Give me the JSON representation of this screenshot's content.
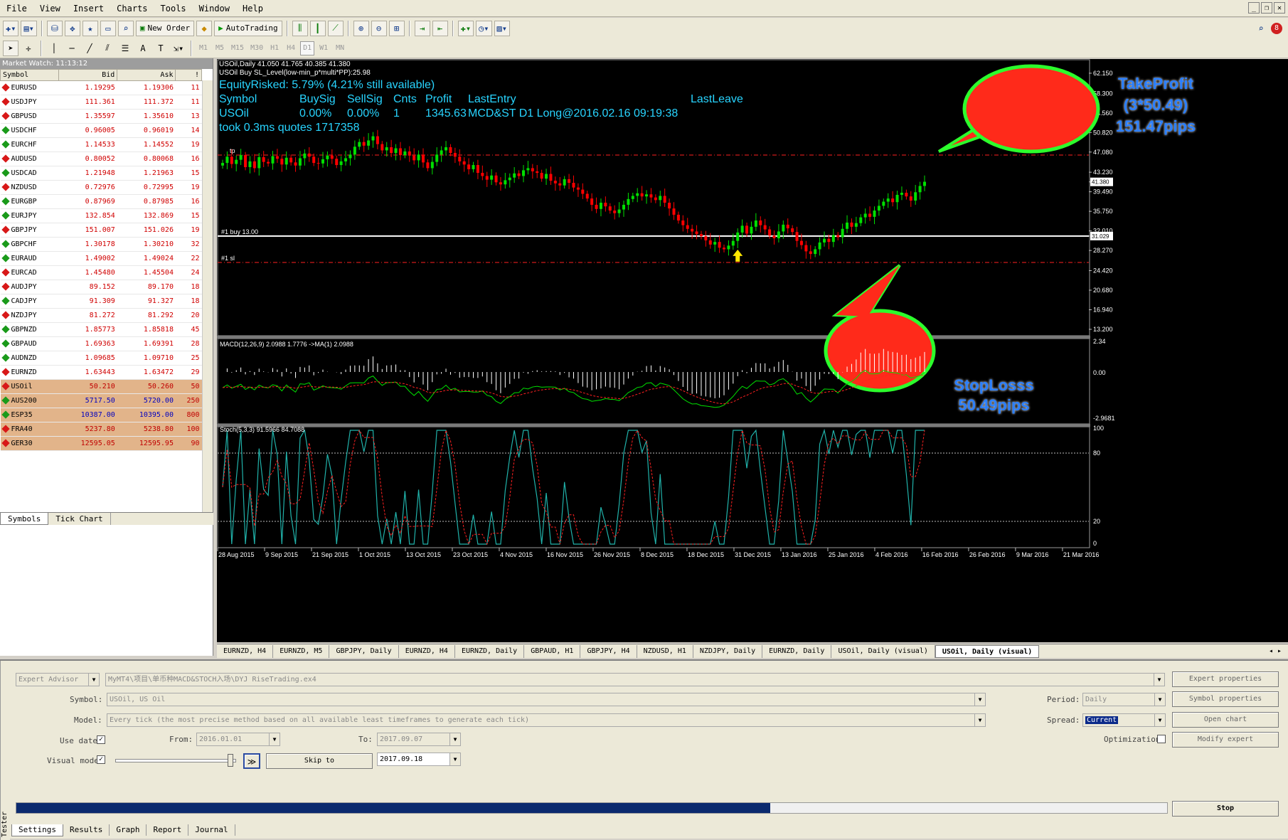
{
  "menu": [
    "File",
    "View",
    "Insert",
    "Charts",
    "Tools",
    "Window",
    "Help"
  ],
  "toolbar": {
    "new_order": "New Order",
    "autotrading": "AutoTrading"
  },
  "timeframes": [
    "M1",
    "M5",
    "M15",
    "M30",
    "H1",
    "H4",
    "D1",
    "W1",
    "MN"
  ],
  "notification_count": "8",
  "market_watch": {
    "title": "Market Watch: 11:13:12",
    "columns": [
      "Symbol",
      "Bid",
      "Ask",
      "!"
    ],
    "rows": [
      {
        "symbol": "EURUSD",
        "bid": "1.19295",
        "ask": "1.19306",
        "spread": "11",
        "dir": "down"
      },
      {
        "symbol": "USDJPY",
        "bid": "111.361",
        "ask": "111.372",
        "spread": "11",
        "dir": "down"
      },
      {
        "symbol": "GBPUSD",
        "bid": "1.35597",
        "ask": "1.35610",
        "spread": "13",
        "dir": "down"
      },
      {
        "symbol": "USDCHF",
        "bid": "0.96005",
        "ask": "0.96019",
        "spread": "14",
        "dir": "up"
      },
      {
        "symbol": "EURCHF",
        "bid": "1.14533",
        "ask": "1.14552",
        "spread": "19",
        "dir": "up"
      },
      {
        "symbol": "AUDUSD",
        "bid": "0.80052",
        "ask": "0.80068",
        "spread": "16",
        "dir": "down"
      },
      {
        "symbol": "USDCAD",
        "bid": "1.21948",
        "ask": "1.21963",
        "spread": "15",
        "dir": "up"
      },
      {
        "symbol": "NZDUSD",
        "bid": "0.72976",
        "ask": "0.72995",
        "spread": "19",
        "dir": "down"
      },
      {
        "symbol": "EURGBP",
        "bid": "0.87969",
        "ask": "0.87985",
        "spread": "16",
        "dir": "up"
      },
      {
        "symbol": "EURJPY",
        "bid": "132.854",
        "ask": "132.869",
        "spread": "15",
        "dir": "up"
      },
      {
        "symbol": "GBPJPY",
        "bid": "151.007",
        "ask": "151.026",
        "spread": "19",
        "dir": "down"
      },
      {
        "symbol": "GBPCHF",
        "bid": "1.30178",
        "ask": "1.30210",
        "spread": "32",
        "dir": "up"
      },
      {
        "symbol": "EURAUD",
        "bid": "1.49002",
        "ask": "1.49024",
        "spread": "22",
        "dir": "up"
      },
      {
        "symbol": "EURCAD",
        "bid": "1.45480",
        "ask": "1.45504",
        "spread": "24",
        "dir": "down"
      },
      {
        "symbol": "AUDJPY",
        "bid": "89.152",
        "ask": "89.170",
        "spread": "18",
        "dir": "down"
      },
      {
        "symbol": "CADJPY",
        "bid": "91.309",
        "ask": "91.327",
        "spread": "18",
        "dir": "up"
      },
      {
        "symbol": "NZDJPY",
        "bid": "81.272",
        "ask": "81.292",
        "spread": "20",
        "dir": "down"
      },
      {
        "symbol": "GBPNZD",
        "bid": "1.85773",
        "ask": "1.85818",
        "spread": "45",
        "dir": "up"
      },
      {
        "symbol": "GBPAUD",
        "bid": "1.69363",
        "ask": "1.69391",
        "spread": "28",
        "dir": "up"
      },
      {
        "symbol": "AUDNZD",
        "bid": "1.09685",
        "ask": "1.09710",
        "spread": "25",
        "dir": "up"
      },
      {
        "symbol": "EURNZD",
        "bid": "1.63443",
        "ask": "1.63472",
        "spread": "29",
        "dir": "down"
      },
      {
        "symbol": "USOil",
        "bid": "50.210",
        "ask": "50.260",
        "spread": "50",
        "dir": "down",
        "idx": true
      },
      {
        "symbol": "AUS200",
        "bid": "5717.50",
        "ask": "5720.00",
        "spread": "250",
        "dir": "up",
        "idx": true,
        "blue": true
      },
      {
        "symbol": "ESP35",
        "bid": "10387.00",
        "ask": "10395.00",
        "spread": "800",
        "dir": "up",
        "idx": true,
        "blue": true
      },
      {
        "symbol": "FRA40",
        "bid": "5237.80",
        "ask": "5238.80",
        "spread": "100",
        "dir": "down",
        "idx": true
      },
      {
        "symbol": "GER30",
        "bid": "12595.05",
        "ask": "12595.95",
        "spread": "90",
        "dir": "down",
        "idx": true
      }
    ],
    "tabs": [
      "Symbols",
      "Tick Chart"
    ]
  },
  "chart": {
    "header1": "USOil,Daily  41.050 41.765 40.385 41.380",
    "header2": "USOil Buy SL_Level(low-min_p*multi*PP):25.98",
    "ea_line1": "EquityRisked: 5.79% (4.21% still available)",
    "ea_headers": [
      "Symbol",
      "BuySig",
      "SellSig",
      "Cnts",
      "Profit",
      "LastEntry",
      "LastLeave"
    ],
    "ea_values": [
      "USOil",
      "0.00%",
      "0.00%",
      "1",
      "1345.63",
      "MCD&ST D1 Long@2016.02.16 09:19:38"
    ],
    "ea_line4": "took 0.3ms quotes 1717358",
    "buy_label": "#1 buy 13.00",
    "sl_label": "#1 sl",
    "tp_label": "tp",
    "price_axis": [
      "62.150",
      "58.300",
      "54.560",
      "50.820",
      "47.080",
      "43.230",
      "41.380",
      "39.490",
      "35.750",
      "32.010",
      "31.029",
      "28.270",
      "24.420",
      "20.680",
      "16.940",
      "13.200"
    ],
    "macd_label": "MACD(12,26,9) 2.0988 1.7776  ->MA(1) 2.0988",
    "macd_axis": [
      "2.34",
      "0.00",
      "-2.9681"
    ],
    "stoch_label": "Stoch(5,3,3) 91.5966 84.7088",
    "stoch_axis": [
      "100",
      "80",
      "20",
      "0"
    ],
    "dates": [
      "28 Aug 2015",
      "9 Sep 2015",
      "21 Sep 2015",
      "1 Oct 2015",
      "13 Oct 2015",
      "23 Oct 2015",
      "4 Nov 2015",
      "16 Nov 2015",
      "26 Nov 2015",
      "8 Dec 2015",
      "18 Dec 2015",
      "31 Dec 2015",
      "13 Jan 2016",
      "25 Jan 2016",
      "4 Feb 2016",
      "16 Feb 2016",
      "26 Feb 2016",
      "9 Mar 2016",
      "21 Mar 2016"
    ],
    "tp_bubble": [
      "TakeProfit",
      "(3*50.49)",
      "151.47pips"
    ],
    "sl_bubble": [
      "StopLosss",
      "50.49pips"
    ]
  },
  "chart_data": {
    "type": "candlestick",
    "symbol": "USOil",
    "timeframe": "Daily",
    "ylim": [
      13.2,
      63.5
    ],
    "entry_price": 31.029,
    "stop_loss": 25.98,
    "take_profit": 46.5,
    "closes": [
      45.0,
      46.2,
      44.8,
      45.6,
      46.5,
      44.2,
      45.3,
      44.0,
      46.1,
      45.2,
      44.9,
      46.3,
      45.8,
      44.7,
      46.0,
      45.1,
      44.5,
      45.9,
      46.8,
      46.2,
      45.0,
      44.9,
      45.7,
      46.4,
      45.8,
      44.6,
      45.3,
      45.9,
      46.6,
      48.1,
      49.0,
      48.3,
      49.3,
      50.1,
      48.6,
      47.4,
      48.0,
      46.9,
      47.8,
      46.5,
      47.2,
      46.4,
      45.5,
      46.6,
      45.1,
      44.0,
      45.2,
      46.6,
      47.4,
      48.0,
      46.9,
      46.2,
      45.3,
      44.7,
      43.8,
      44.6,
      43.1,
      42.5,
      41.8,
      42.6,
      41.3,
      40.9,
      41.7,
      42.2,
      43.0,
      42.5,
      43.6,
      44.0,
      43.4,
      43.1,
      42.0,
      42.9,
      41.6,
      41.1,
      40.7,
      41.9,
      41.2,
      40.3,
      39.9,
      39.1,
      38.2,
      37.0,
      36.2,
      37.4,
      36.7,
      35.9,
      35.4,
      36.1,
      37.0,
      38.1,
      38.7,
      39.2,
      38.6,
      39.0,
      38.4,
      37.9,
      38.7,
      37.4,
      36.3,
      35.1,
      34.0,
      33.1,
      32.4,
      31.9,
      31.4,
      31.0,
      30.2,
      29.4,
      29.9,
      28.8,
      28.5,
      29.2,
      30.1,
      31.7,
      33.0,
      31.5,
      32.8,
      34.0,
      33.1,
      32.3,
      31.1,
      30.6,
      31.9,
      33.2,
      32.5,
      31.8,
      30.1,
      29.3,
      28.1,
      27.6,
      28.5,
      29.8,
      30.5,
      29.9,
      31.2,
      30.8,
      32.4,
      33.6,
      32.8,
      33.5,
      34.6,
      35.3,
      34.7,
      35.9,
      36.8,
      37.6,
      38.2,
      37.5,
      38.9,
      39.3,
      38.6,
      37.8,
      39.4,
      40.6,
      41.4
    ]
  },
  "chart_tabs": [
    "EURNZD, H4",
    "EURNZD, M5",
    "GBPJPY, Daily",
    "EURNZD, H4",
    "EURNZD, Daily",
    "GBPAUD, H1",
    "GBPJPY, H4",
    "NZDUSD, H1",
    "NZDJPY, Daily",
    "EURNZD, Daily",
    "USOil, Daily (visual)",
    "USOil, Daily (visual)"
  ],
  "tester": {
    "side_label": "Tester",
    "type": "Expert Advisor",
    "ea_path": "MyMT4\\项目\\单币种MACD&STOCH入场\\DYJ RiseTrading.ex4",
    "symbol_label": "Symbol:",
    "symbol": "USOil, US Oil",
    "model_label": "Model:",
    "model": "Every tick (the most precise method based on all available least timeframes to generate each tick)",
    "use_date_label": "Use date",
    "from_label": "From:",
    "from": "2016.01.01",
    "to_label": "To:",
    "to": "2017.09.07",
    "visual_mode_label": "Visual mode",
    "skip_to": "Skip to",
    "skip_date": "2017.09.18",
    "period_label": "Period:",
    "period": "Daily",
    "spread_label": "Spread:",
    "spread": "Current",
    "optimization_label": "Optimization",
    "buttons": [
      "Expert properties",
      "Symbol properties",
      "Open chart",
      "Modify expert"
    ],
    "stop": "Stop",
    "progress": 0.655,
    "tabs": [
      "Settings",
      "Results",
      "Graph",
      "Report",
      "Journal"
    ]
  },
  "colors": {
    "bull": "#00e000",
    "bear": "#ff0000",
    "info": "#28d4ff",
    "bubble_fill": "#ff2a1a",
    "bubble_stroke": "#2cff2c",
    "bubble_text": "#2a7fff"
  }
}
